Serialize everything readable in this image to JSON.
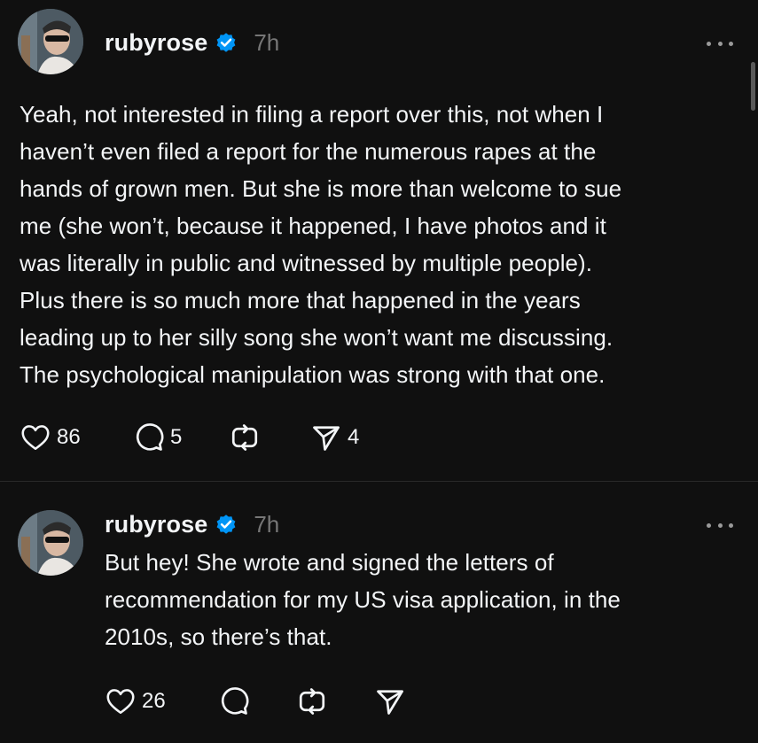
{
  "posts": [
    {
      "author": {
        "username": "rubyrose",
        "verified": true,
        "avatar": "avatar-photo"
      },
      "time": "7h",
      "text": "Yeah, not interested in filing a report over this, not when I\nhaven’t even filed a report for the numerous rapes at the\nhands of grown men. But she is more than welcome to sue\nme (she won’t, because it happened, I have photos and it\nwas literally in public and witnessed by multiple people).\nPlus there is so much more that happened in the years\nleading up to her silly song she won’t want me discussing.\nThe psychological manipulation was strong with that one.",
      "stats": {
        "likes": "86",
        "replies": "5",
        "reposts": "",
        "shares": "4"
      }
    },
    {
      "author": {
        "username": "rubyrose",
        "verified": true,
        "avatar": "avatar-photo"
      },
      "time": "7h",
      "text": "But hey! She wrote and signed the letters of\nrecommendation for my US visa application, in the\n2010s, so there’s that.",
      "stats": {
        "likes": "26",
        "replies": "",
        "reposts": "",
        "shares": ""
      }
    }
  ],
  "icons": {
    "verified": "verified-badge-icon",
    "more": "more-options-icon",
    "like": "heart-icon",
    "reply": "comment-icon",
    "repost": "repost-icon",
    "share": "send-icon"
  },
  "colors": {
    "background": "#101010",
    "text": "#f3f5f7",
    "muted": "#777777",
    "verified": "#0095f6"
  }
}
